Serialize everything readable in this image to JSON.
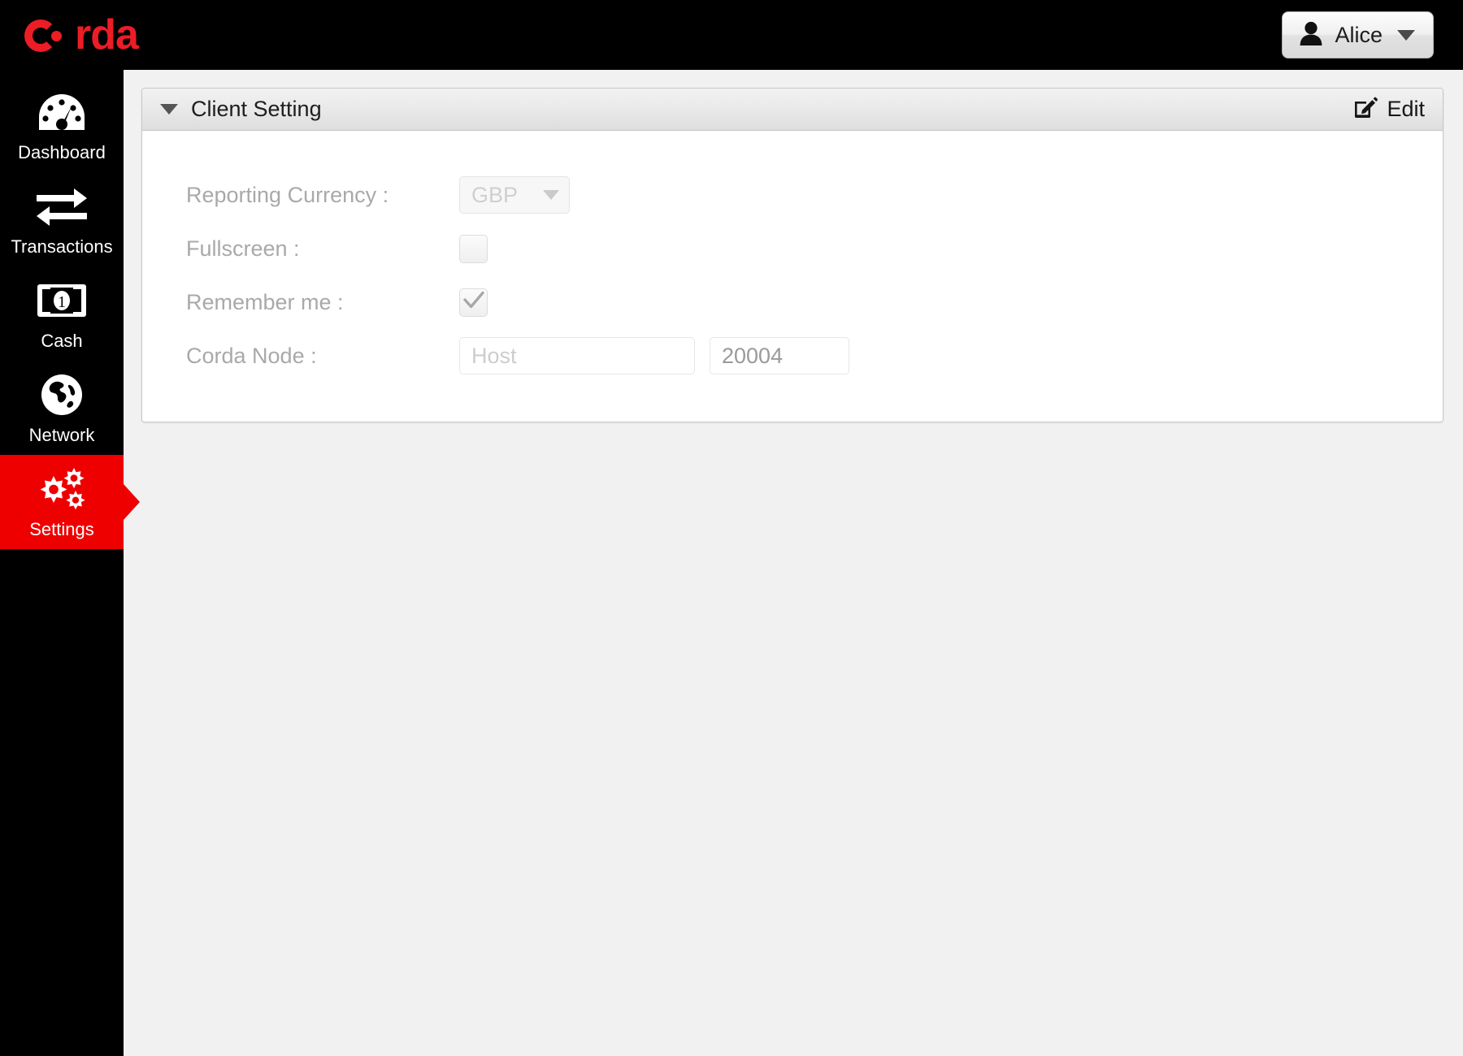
{
  "brand": {
    "logo_text": "c rda",
    "logo_prefix": "c",
    "logo_suffix": "rda",
    "logo_color": "#ec1d25"
  },
  "topbar": {
    "user_button": {
      "name": "Alice",
      "icon": "person-icon",
      "caret": "chevron-down-icon"
    }
  },
  "sidebar": {
    "active_color": "#ee0000",
    "items": [
      {
        "label": "Dashboard",
        "icon": "dashboard-gauge-icon",
        "active": false
      },
      {
        "label": "Transactions",
        "icon": "exchange-arrows-icon",
        "active": false
      },
      {
        "label": "Cash",
        "icon": "banknote-icon",
        "active": false
      },
      {
        "label": "Network",
        "icon": "globe-icon",
        "active": false
      },
      {
        "label": "Settings",
        "icon": "gears-icon",
        "active": true
      }
    ]
  },
  "panel": {
    "title": "Client Setting",
    "collapse_icon": "triangle-down-icon",
    "edit_label": "Edit",
    "edit_icon": "pencil-square-icon",
    "fields": {
      "reporting_currency": {
        "label": "Reporting Currency :",
        "value": "GBP",
        "disabled": true
      },
      "fullscreen": {
        "label": "Fullscreen :",
        "checked": false
      },
      "remember_me": {
        "label": "Remember me :",
        "checked": true
      },
      "corda_node": {
        "label": "Corda Node :",
        "host_placeholder": "Host",
        "host_value": "",
        "port_value": "20004"
      }
    }
  }
}
